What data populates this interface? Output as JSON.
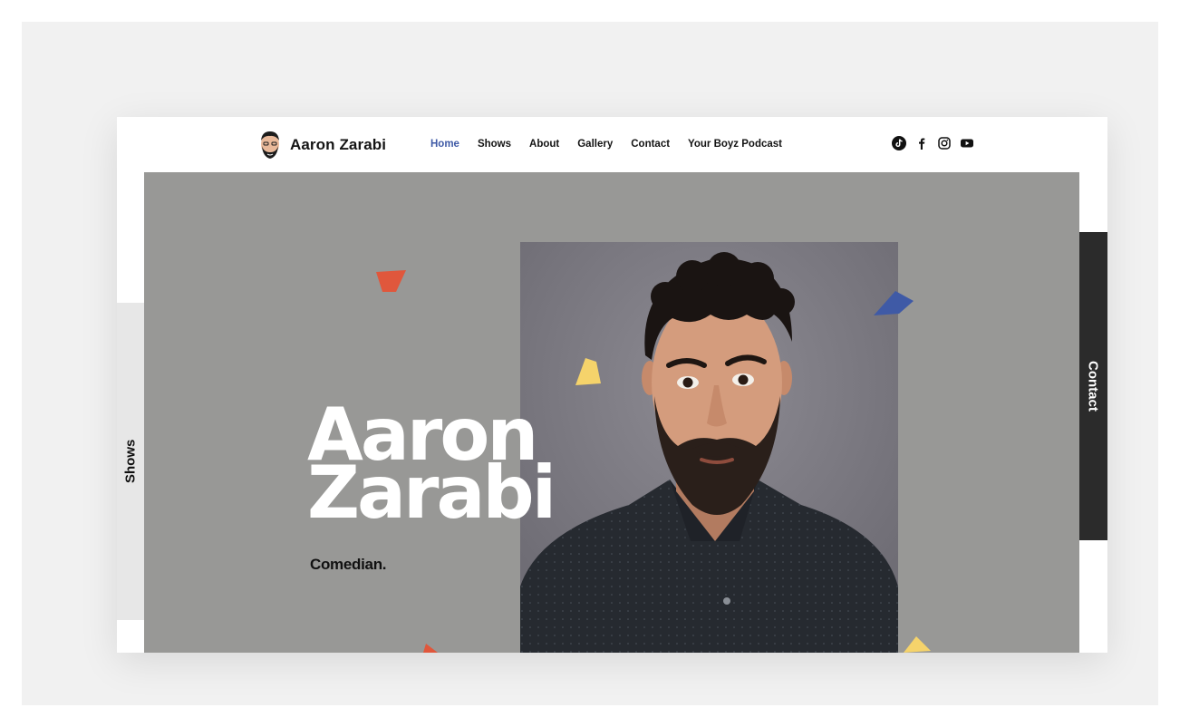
{
  "header": {
    "site_name": "Aaron Zarabi",
    "nav": [
      {
        "label": "Home",
        "active": true
      },
      {
        "label": "Shows",
        "active": false
      },
      {
        "label": "About",
        "active": false
      },
      {
        "label": "Gallery",
        "active": false
      },
      {
        "label": "Contact",
        "active": false
      },
      {
        "label": "Your Boyz Podcast",
        "active": false
      }
    ],
    "social_icons": [
      "tiktok-icon",
      "facebook-icon",
      "instagram-icon",
      "youtube-icon"
    ]
  },
  "hero": {
    "title_line1": "Aaron",
    "title_line2": "Zarabi",
    "subtitle": "Comedian."
  },
  "side_tabs": {
    "left": "Shows",
    "right": "Contact"
  },
  "colors": {
    "nav_active": "#3f5aa6",
    "hero_bg": "#989896",
    "confetti_red": "#e0573c",
    "confetti_blue": "#3f5aa6",
    "confetti_yellow": "#f5d36b"
  }
}
